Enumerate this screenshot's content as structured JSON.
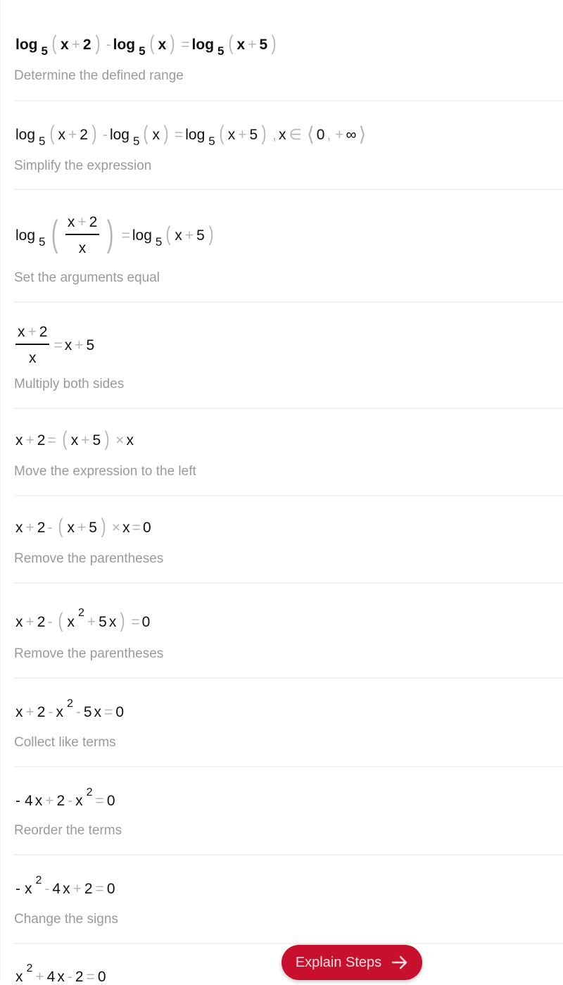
{
  "steps": [
    {
      "expression_text": "log_5(x + 2) - log_5(x) = log_5(x + 5)",
      "tokens": {
        "log": "log",
        "base": "5",
        "x": "x",
        "plus": "+",
        "minus": "-",
        "eq": "=",
        "two": "2",
        "five": "5"
      },
      "description": "Determine the defined range"
    },
    {
      "expression_text": "log_5(x + 2) - log_5(x) = log_5(x + 5), x ∈ ⟨0, +∞⟩",
      "domain": {
        "lower": "0",
        "upper": "∞",
        "in_symbol": "∈",
        "comma": ","
      },
      "description": "Simplify the expression"
    },
    {
      "expression_text": "log_5((x + 2)/x) = log_5(x + 5)",
      "description": "Set the arguments equal"
    },
    {
      "expression_text": "(x + 2)/x = x + 5",
      "description": "Multiply both sides"
    },
    {
      "expression_text": "x + 2 = (x + 5) × x",
      "times": "×",
      "description": "Move the expression to the left"
    },
    {
      "expression_text": "x + 2 - (x + 5) × x = 0",
      "zero": "0",
      "description": "Remove the parentheses"
    },
    {
      "expression_text": "x + 2 - (x^2 + 5x) = 0",
      "exponent": "2",
      "description": "Remove the parentheses"
    },
    {
      "expression_text": "x + 2 - x^2 - 5x = 0",
      "description": "Collect like terms"
    },
    {
      "expression_text": "- 4x + 2 - x^2 = 0",
      "coef": "4",
      "description": "Reorder the terms"
    },
    {
      "expression_text": "- x^2 - 4x + 2 = 0",
      "description": "Change the signs"
    },
    {
      "expression_text": "x^2 + 4x - 2 = 0"
    }
  ],
  "explain_button": {
    "label": "Explain Steps",
    "icon": "arrow-right-icon",
    "color": "#c8102e"
  }
}
